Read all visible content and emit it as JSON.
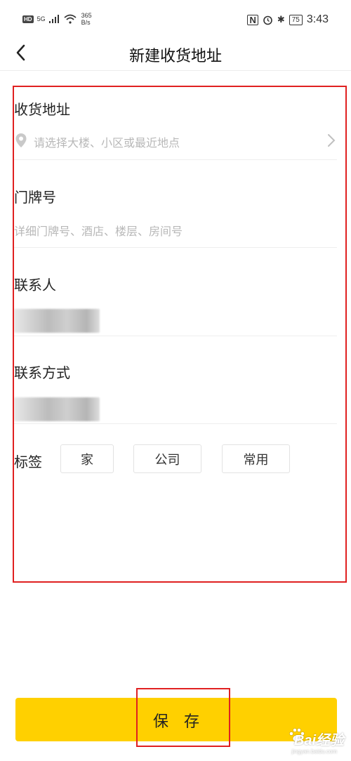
{
  "status_bar": {
    "hd": "HD",
    "signal": "5G",
    "speed_value": "365",
    "speed_unit": "B/s",
    "nfc": "N",
    "bluetooth": "✱",
    "battery": "75",
    "time": "3:43"
  },
  "nav": {
    "title": "新建收货地址"
  },
  "form": {
    "address_label": "收货地址",
    "address_placeholder": "请选择大楼、小区或最近地点",
    "door_label": "门牌号",
    "door_placeholder": "详细门牌号、酒店、楼层、房间号",
    "contact_label": "联系人",
    "phone_label": "联系方式",
    "tag_label": "标签",
    "tags": [
      "家",
      "公司",
      "常用"
    ]
  },
  "footer": {
    "save_label": "保存"
  },
  "watermark": {
    "text": "Bai经验",
    "sub": "jingyan.baidu.com"
  },
  "colors": {
    "accent": "#ffd000",
    "annotation": "#e02020",
    "placeholder": "#b8b8b8"
  }
}
